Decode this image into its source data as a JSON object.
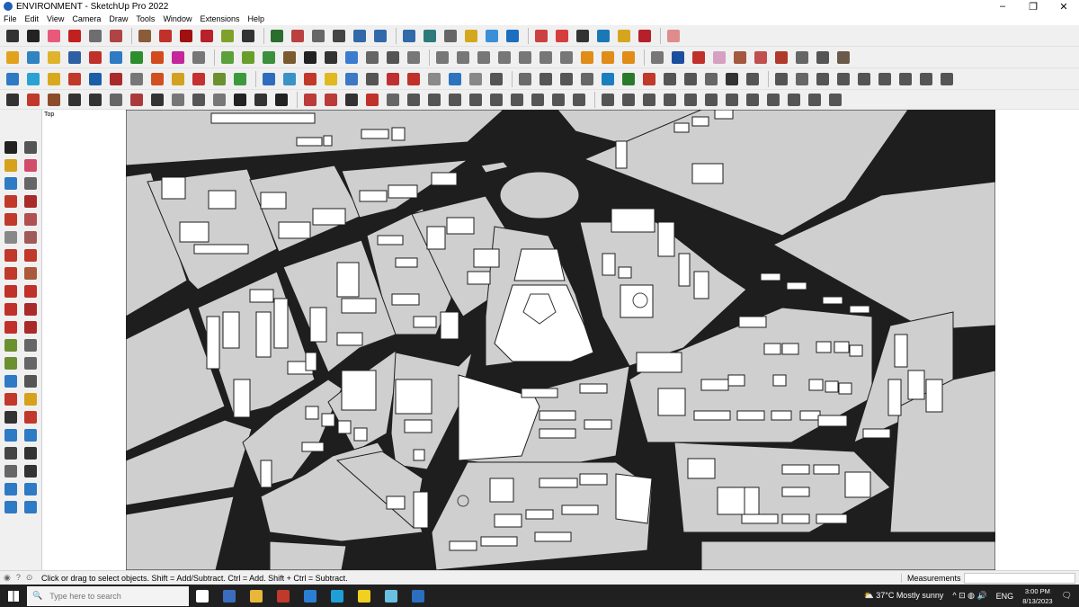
{
  "window": {
    "title": "ENVIRONMENT - SketchUp Pro 2022",
    "minimize_glyph": "–",
    "restore_glyph": "❐",
    "close_glyph": "✕"
  },
  "menu": [
    "File",
    "Edit",
    "View",
    "Camera",
    "Draw",
    "Tools",
    "Window",
    "Extensions",
    "Help"
  ],
  "toolbar": {
    "row1_colors": [
      "#333",
      "#222",
      "#e85a7a",
      "#c21f1f",
      "#6e6e6e",
      "#b04343",
      "#8b5c3a",
      "#c0312a",
      "#a01010",
      "#b8202a",
      "#7fa12a",
      "#333",
      "#2b6d2d",
      "#bb4040",
      "#666",
      "#444",
      "#3169a9",
      "#3169a9",
      "#3169a9",
      "#2c7a7a",
      "#666",
      "#d3a81e",
      "#3a8fd8",
      "#1c6fbf",
      "#cc4040",
      "#d63d3d",
      "#333",
      "#1a78b5",
      "#d6a520",
      "#b5202a",
      "#de8c8c"
    ],
    "row2_colors": [
      "#e3a21c",
      "#2f84c1",
      "#e0b32d",
      "#2f5fa3",
      "#c0312a",
      "#2f7ac4",
      "#2d8e2d",
      "#d34b1c",
      "#c5269a",
      "#777",
      "#5aa13c",
      "#6a9e2b",
      "#3c8f3c",
      "#7a5a2e",
      "#222",
      "#333",
      "#3a7ccf",
      "#666",
      "#555",
      "#777",
      "#777",
      "#777",
      "#777",
      "#777",
      "#777",
      "#777",
      "#777",
      "#e08c16",
      "#e08c16",
      "#e08c16",
      "#777",
      "#1a4f9e",
      "#c0312a",
      "#d6a0c0",
      "#a55840",
      "#c05050",
      "#b03a2a",
      "#666",
      "#555",
      "#6b5a4a"
    ],
    "row3_colors": [
      "#2f7ac4",
      "#2aa3d4",
      "#d8a91e",
      "#c0392b",
      "#1c5fa8",
      "#aa2a2a",
      "#777",
      "#d05020",
      "#d2a11f",
      "#c53030",
      "#6a9030",
      "#3c9a3c",
      "#2e6dbd",
      "#3a92c7",
      "#c0392b",
      "#e0b820",
      "#3c78c3",
      "#555",
      "#c03030",
      "#c0312a",
      "#8a8a8a",
      "#2d74be",
      "#888",
      "#555",
      "#6b6b6b",
      "#555",
      "#555",
      "#666",
      "#1a7fbf",
      "#2b7a2b",
      "#c0392b",
      "#555",
      "#555",
      "#666",
      "#333",
      "#555",
      "#555",
      "#666",
      "#555",
      "#555",
      "#555",
      "#555",
      "#555",
      "#555",
      "#555"
    ],
    "row4_colors": [
      "#333",
      "#c0392b",
      "#8b4a2a",
      "#333",
      "#333",
      "#666",
      "#aa3a3a",
      "#333",
      "#777",
      "#555",
      "#777",
      "#222",
      "#333",
      "#222",
      "#bb3a3a",
      "#bb3a3a",
      "#333",
      "#c0312a",
      "#666",
      "#555",
      "#555",
      "#555",
      "#555",
      "#555",
      "#555",
      "#555",
      "#555",
      "#555",
      "#555",
      "#555",
      "#555",
      "#555",
      "#555",
      "#555",
      "#555",
      "#555",
      "#555",
      "#555",
      "#555",
      "#555",
      "#555",
      "#555",
      "#555",
      "#555",
      "#555",
      "#555",
      "#555",
      "#555",
      "#555",
      "#555"
    ]
  },
  "left_tools": [
    {
      "name": "select-icon",
      "color": "#222"
    },
    {
      "name": "orbit-icon",
      "color": "#555"
    },
    {
      "name": "paint-bucket-icon",
      "color": "#d6a21c"
    },
    {
      "name": "eraser-icon",
      "color": "#d24d6a"
    },
    {
      "name": "component-icon",
      "color": "#2f7ac4"
    },
    {
      "name": "tape-icon",
      "color": "#666"
    },
    {
      "name": "line-icon",
      "color": "#c0392b"
    },
    {
      "name": "freehand-icon",
      "color": "#aa2a2a"
    },
    {
      "name": "rectangle-icon",
      "color": "#c0392b"
    },
    {
      "name": "rotated-rectangle-icon",
      "color": "#b05050"
    },
    {
      "name": "circle-icon",
      "color": "#888"
    },
    {
      "name": "polygon-icon",
      "color": "#a05a5a"
    },
    {
      "name": "arc-icon",
      "color": "#c0392b"
    },
    {
      "name": "pie-icon",
      "color": "#c0392b"
    },
    {
      "name": "arc-3pt-icon",
      "color": "#c0392b"
    },
    {
      "name": "arc-2pt-icon",
      "color": "#aa5a3a"
    },
    {
      "name": "move-icon",
      "color": "#c0312a"
    },
    {
      "name": "pushpull-icon",
      "color": "#c0312a"
    },
    {
      "name": "rotate-icon",
      "color": "#c0312a"
    },
    {
      "name": "followme-icon",
      "color": "#aa2a2a"
    },
    {
      "name": "scale-icon",
      "color": "#c0312a"
    },
    {
      "name": "offset-icon",
      "color": "#aa2a2a"
    },
    {
      "name": "tapemeasure-icon",
      "color": "#6a9030"
    },
    {
      "name": "dimension-icon",
      "color": "#666"
    },
    {
      "name": "protractor-icon",
      "color": "#6a9030"
    },
    {
      "name": "text-icon",
      "color": "#666"
    },
    {
      "name": "axes-icon",
      "color": "#2f7ac4"
    },
    {
      "name": "3dtext-icon",
      "color": "#555"
    },
    {
      "name": "orbit2-icon",
      "color": "#c0392b"
    },
    {
      "name": "pan-icon",
      "color": "#d6a21c"
    },
    {
      "name": "zoom-icon",
      "color": "#333"
    },
    {
      "name": "zoom-window-icon",
      "color": "#c0392b"
    },
    {
      "name": "zoom-extents-icon",
      "color": "#2f7ac4"
    },
    {
      "name": "previous-view-icon",
      "color": "#2f7ac4"
    },
    {
      "name": "position-camera-icon",
      "color": "#444"
    },
    {
      "name": "lookaround-icon",
      "color": "#333"
    },
    {
      "name": "walk-icon",
      "color": "#666"
    },
    {
      "name": "section-plane-icon",
      "color": "#333"
    },
    {
      "name": "sandbox-icon",
      "color": "#2f7ac4"
    },
    {
      "name": "stamp-icon",
      "color": "#2f7ac4"
    },
    {
      "name": "drape-icon",
      "color": "#2f7ac4"
    },
    {
      "name": "flip-edge-icon",
      "color": "#2f7ac4"
    }
  ],
  "viewport": {
    "scene_label": "Top"
  },
  "status": {
    "message": "Click or drag to select objects. Shift = Add/Subtract. Ctrl = Add. Shift + Ctrl = Subtract.",
    "measurements_label": "Measurements",
    "status_glyphs": [
      "◉",
      "?",
      "⊙"
    ]
  },
  "taskbar": {
    "search_placeholder": "Type here to search",
    "search_glyph": "🔍",
    "apps": [
      {
        "name": "task-view-icon",
        "color": "#ffffff"
      },
      {
        "name": "calculator-icon",
        "color": "#3b6dbf"
      },
      {
        "name": "file-explorer-icon",
        "color": "#e8b73a"
      },
      {
        "name": "acrobat-icon",
        "color": "#c0392b"
      },
      {
        "name": "store-icon",
        "color": "#2a7fd4"
      },
      {
        "name": "edge-icon",
        "color": "#1e9fd8"
      },
      {
        "name": "sticky-notes-icon",
        "color": "#f0d020"
      },
      {
        "name": "layout-icon",
        "color": "#6ac0e0"
      },
      {
        "name": "sketchup-icon",
        "color": "#2a6fc0"
      }
    ],
    "weather_glyph": "⛅",
    "weather": "37°C  Mostly sunny",
    "tray_glyphs": "^  ⊡  ◍  🔊",
    "language": "ENG",
    "time": "3:00 PM",
    "date": "8/13/2023",
    "notification_glyph": "🗨"
  }
}
